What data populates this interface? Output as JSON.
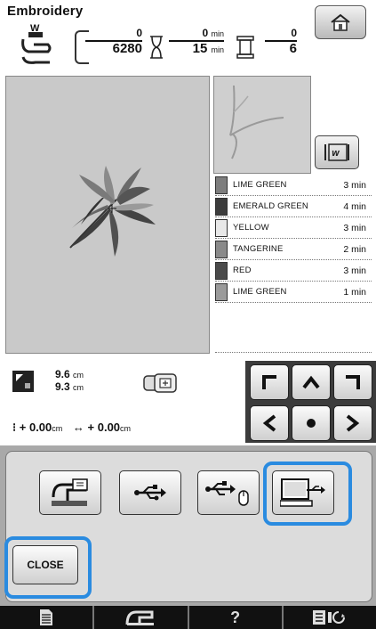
{
  "header": {
    "title": "Embroidery"
  },
  "status": {
    "stitch_current": "0",
    "stitch_total": "6280",
    "time_current": "0",
    "time_total": "15",
    "time_unit": "min",
    "color_current": "0",
    "color_total": "6"
  },
  "colors": [
    {
      "name": "LIME GREEN",
      "time": "3 min",
      "swatch": "#7d7d7d"
    },
    {
      "name": "EMERALD GREEN",
      "time": "4 min",
      "swatch": "#3c3c3c"
    },
    {
      "name": "YELLOW",
      "time": "3 min",
      "swatch": "#e8e8e8"
    },
    {
      "name": "TANGERINE",
      "time": "2 min",
      "swatch": "#8a8a8a"
    },
    {
      "name": "RED",
      "time": "3 min",
      "swatch": "#4a4a4a"
    },
    {
      "name": "LIME GREEN",
      "time": "1 min",
      "swatch": "#9a9a9a"
    }
  ],
  "size": {
    "height": "9.6",
    "width": "9.3",
    "unit": "cm"
  },
  "position": {
    "y": "+ 0.00",
    "x": "+ 0.00",
    "unit": "cm"
  },
  "popup": {
    "close_label": "CLOSE"
  },
  "accent": "#2a8be0"
}
